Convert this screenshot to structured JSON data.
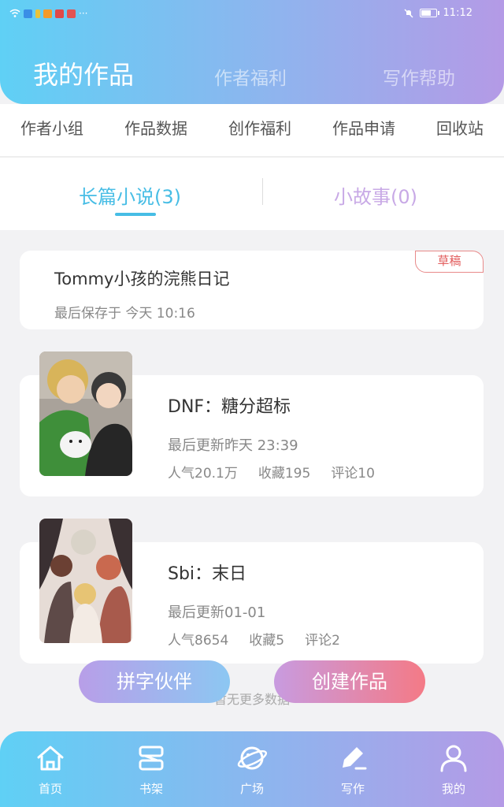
{
  "status_bar": {
    "time": "11:12"
  },
  "header": {
    "tabs": [
      {
        "label": "我的作品"
      },
      {
        "label": "作者福利"
      },
      {
        "label": "写作帮助"
      }
    ]
  },
  "menu": {
    "items": [
      {
        "label": "作者小组"
      },
      {
        "label": "作品数据"
      },
      {
        "label": "创作福利"
      },
      {
        "label": "作品申请"
      },
      {
        "label": "回收站"
      }
    ]
  },
  "subtabs": [
    {
      "label": "长篇小说(3)"
    },
    {
      "label": "小故事(0)"
    }
  ],
  "draft": {
    "title": "Tommy小孩的浣熊日记",
    "meta": "最后保存于 今天 10:16",
    "badge": "草稿"
  },
  "novels": [
    {
      "title": "DNF：糖分超标",
      "update": "最后更新昨天 23:39",
      "popularity": "人气20.1万",
      "favorites": "收藏195",
      "comments": "评论10"
    },
    {
      "title": "Sbi：末日",
      "update": "最后更新01-01",
      "popularity": "人气8654",
      "favorites": "收藏5",
      "comments": "评论2"
    }
  ],
  "no_more": "暂无更多数据",
  "fab": {
    "partner": "拼字伙伴",
    "create": "创建作品"
  },
  "bottom_nav": [
    {
      "label": "首页",
      "icon": "home-icon"
    },
    {
      "label": "书架",
      "icon": "bookshelf-icon"
    },
    {
      "label": "广场",
      "icon": "planet-icon"
    },
    {
      "label": "写作",
      "icon": "pen-icon"
    },
    {
      "label": "我的",
      "icon": "profile-icon"
    }
  ]
}
